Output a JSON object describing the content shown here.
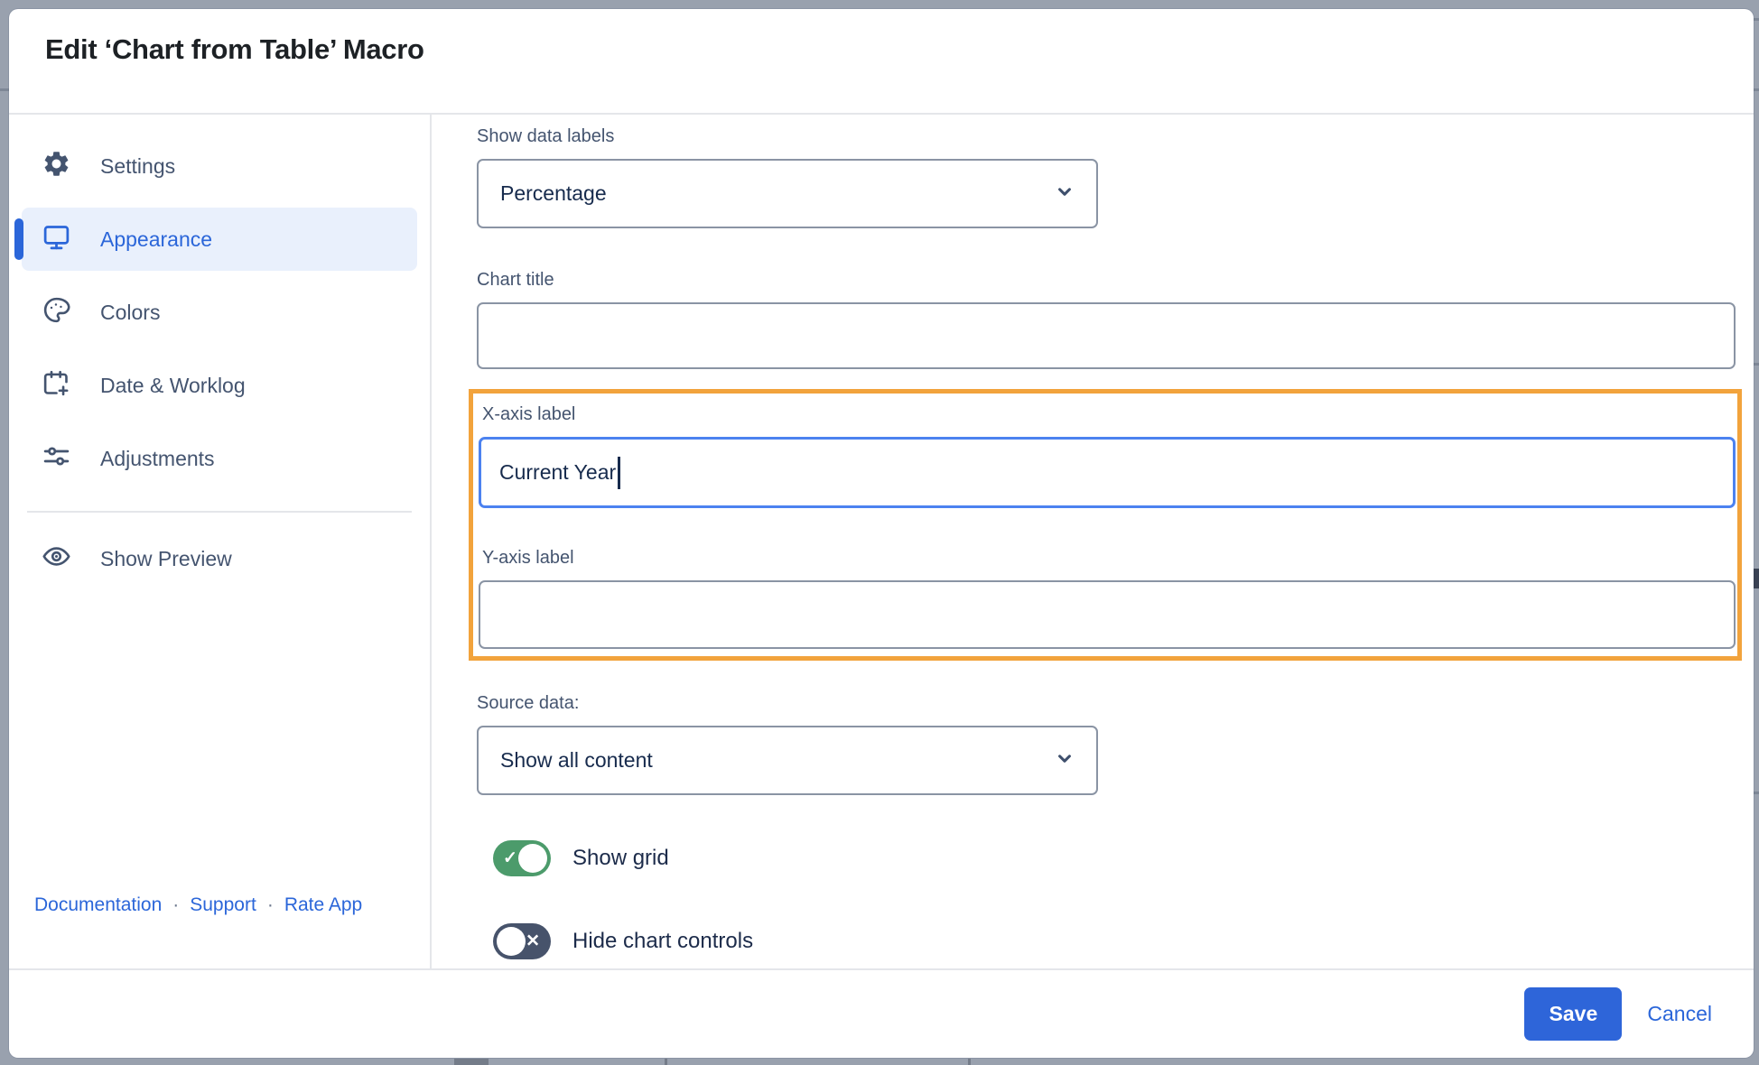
{
  "dialog": {
    "title": "Edit ‘Chart from Table’ Macro"
  },
  "sidebar": {
    "items": [
      {
        "label": "Settings",
        "icon": "gear",
        "selected": false
      },
      {
        "label": "Appearance",
        "icon": "monitor",
        "selected": true
      },
      {
        "label": "Colors",
        "icon": "palette",
        "selected": false
      },
      {
        "label": "Date & Worklog",
        "icon": "calendar-plus",
        "selected": false
      },
      {
        "label": "Adjustments",
        "icon": "sliders",
        "selected": false
      }
    ],
    "preview": {
      "label": "Show Preview",
      "icon": "eye"
    },
    "links": [
      {
        "label": "Documentation"
      },
      {
        "label": "Support"
      },
      {
        "label": "Rate App"
      }
    ],
    "separator": "·"
  },
  "form": {
    "show_data_labels": {
      "label": "Show data labels",
      "value": "Percentage"
    },
    "chart_title": {
      "label": "Chart title",
      "value": ""
    },
    "x_axis": {
      "label": "X-axis label",
      "value": "Current Year",
      "focused": true
    },
    "y_axis": {
      "label": "Y-axis label",
      "value": ""
    },
    "source_data": {
      "label": "Source data:",
      "value": "Show all content"
    },
    "show_grid": {
      "label": "Show grid",
      "state": "on"
    },
    "hide_chart_controls": {
      "label": "Hide chart controls",
      "state": "off"
    },
    "toggle_on_glyph": "✓",
    "toggle_off_glyph": "✕"
  },
  "footer": {
    "save_label": "Save",
    "cancel_label": "Cancel"
  },
  "colors": {
    "accent_blue": "#2B66D9",
    "focus_blue": "#4C82F0",
    "highlight_orange": "#F2A33C",
    "toggle_on_green": "#4C9B6B",
    "toggle_off_slate": "#47536B",
    "backdrop_gray": "#99A1AE"
  }
}
